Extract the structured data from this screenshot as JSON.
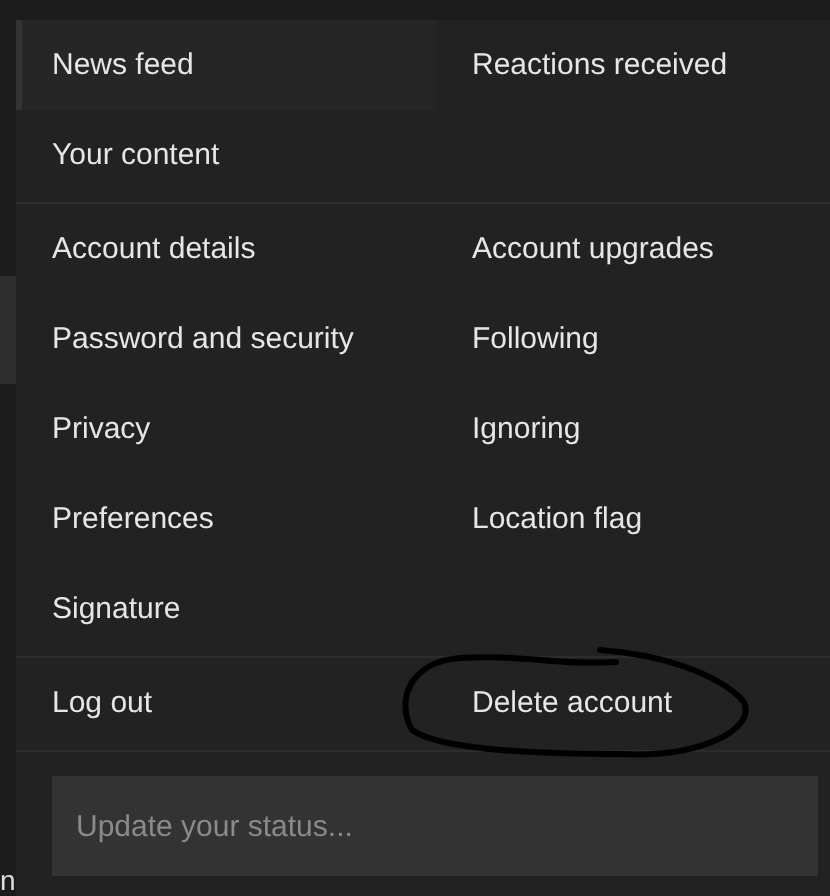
{
  "menu": {
    "sections": [
      {
        "left": [
          {
            "label": "News feed",
            "selected": true
          },
          {
            "label": "Your content",
            "selected": false
          }
        ],
        "right": [
          {
            "label": "Reactions received",
            "selected": false
          }
        ]
      },
      {
        "left": [
          {
            "label": "Account details",
            "selected": false
          },
          {
            "label": "Password and security",
            "selected": false
          },
          {
            "label": "Privacy",
            "selected": false
          },
          {
            "label": "Preferences",
            "selected": false
          },
          {
            "label": "Signature",
            "selected": false
          }
        ],
        "right": [
          {
            "label": "Account upgrades",
            "selected": false
          },
          {
            "label": "Following",
            "selected": false
          },
          {
            "label": "Ignoring",
            "selected": false
          },
          {
            "label": "Location flag",
            "selected": false
          }
        ]
      },
      {
        "left": [
          {
            "label": "Log out",
            "selected": false
          }
        ],
        "right": [
          {
            "label": "Delete account",
            "selected": false,
            "kind": "circled"
          }
        ]
      }
    ],
    "status_field": {
      "placeholder": "Update your status..."
    }
  },
  "background_text": "n"
}
